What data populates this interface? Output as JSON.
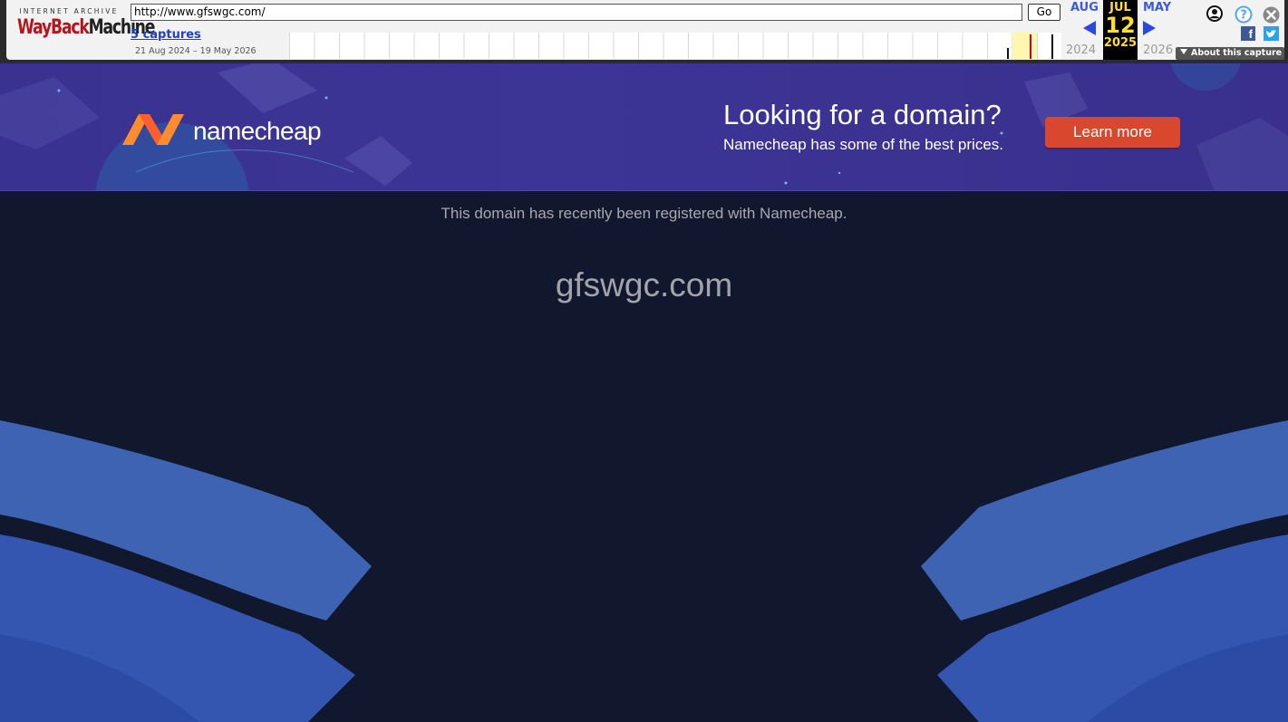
{
  "wayback": {
    "logo_top": "INTERNET ARCHIVE",
    "logo_wayback": "WayBack",
    "logo_machine": "Machine",
    "url": "http://www.gfswgc.com/",
    "go_label": "Go",
    "captures_link": "5 captures",
    "date_range": "21 Aug 2024 – 19 May 2026",
    "prev_month": "AUG",
    "current_month": "JUL",
    "current_day": "12",
    "next_month": "MAY",
    "prev_year": "2024",
    "current_year": "2025",
    "next_year": "2026",
    "about_label": "About this capture",
    "facebook_glyph": "f",
    "icons": [
      "user-icon",
      "help-icon",
      "close-icon",
      "facebook-icon",
      "twitter-icon"
    ]
  },
  "banner": {
    "brand": "namecheap",
    "title": "Looking for a domain?",
    "subtitle": "Namecheap has some of the best prices.",
    "cta_label": "Learn more",
    "cta_color": "#d9472e",
    "brand_orange": "#ff6c2c"
  },
  "page": {
    "registered_message": "This domain has recently been registered with Namecheap.",
    "domain_name": "gfswgc.com",
    "background_color": "#11172c"
  }
}
